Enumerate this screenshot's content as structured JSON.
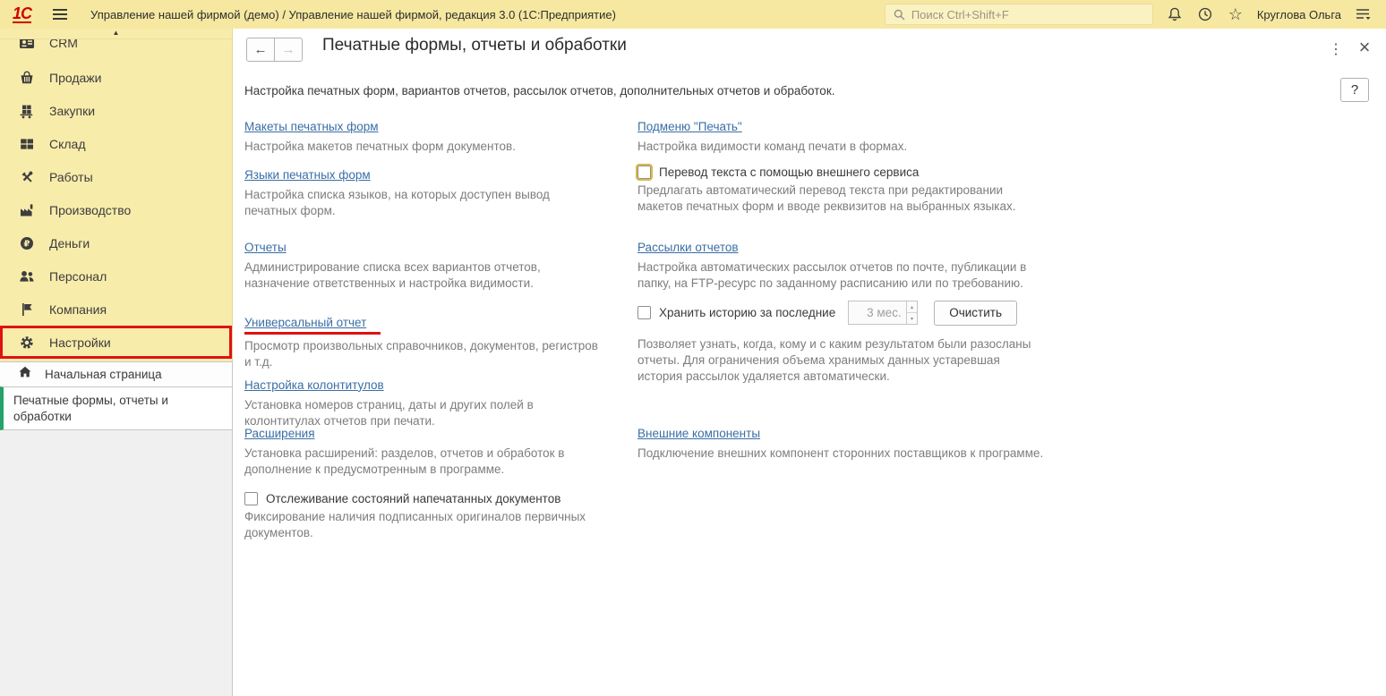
{
  "colors": {
    "topbar_yellow": "#f6e8a0",
    "sidebar_yellow": "#f8ecab",
    "search_yellow": "#fbf2c2",
    "link_blue": "#3a6ea5",
    "highlight_red": "#e01212",
    "tab_green": "#27a268",
    "desc_gray": "#7d7d7d"
  },
  "topbar": {
    "logo_text": "1С",
    "title": "Управление нашей фирмой (демо) / Управление нашей фирмой, редакция 3.0  (1С:Предприятие)",
    "search_placeholder": "Поиск Ctrl+Shift+F",
    "user_name": "Круглова Ольга",
    "icons": [
      "search-icon",
      "bell-icon",
      "history-icon",
      "star-icon",
      "menu-arrow-icon"
    ],
    "star_glyph": "☆"
  },
  "sidebar": {
    "scroll_up_glyph": "▲",
    "items": [
      {
        "label": "CRM",
        "icon": "crm-icon"
      },
      {
        "label": "Продажи",
        "icon": "sales-icon"
      },
      {
        "label": "Закупки",
        "icon": "purchases-icon"
      },
      {
        "label": "Склад",
        "icon": "warehouse-icon"
      },
      {
        "label": "Работы",
        "icon": "works-icon"
      },
      {
        "label": "Производство",
        "icon": "production-icon"
      },
      {
        "label": "Деньги",
        "icon": "money-icon"
      },
      {
        "label": "Персонал",
        "icon": "staff-icon"
      },
      {
        "label": "Компания",
        "icon": "company-icon"
      },
      {
        "label": "Настройки",
        "icon": "settings-icon",
        "highlighted": true
      }
    ],
    "home": {
      "label": "Начальная страница",
      "icon": "home-icon"
    },
    "active_tab": "Печатные формы, отчеты и обработки"
  },
  "content": {
    "back_glyph": "←",
    "forward_glyph": "→",
    "kebab_glyph": "⋮",
    "close_glyph": "×",
    "help_label": "?",
    "title": "Печатные формы, отчеты и обработки",
    "subtitle": "Настройка печатных форм, вариантов отчетов, рассылок отчетов, дополнительных отчетов и обработок.",
    "left_column": {
      "items": [
        {
          "type": "link",
          "label": "Макеты печатных форм",
          "desc": "Настройка макетов печатных форм документов."
        },
        {
          "type": "link",
          "label": "Языки печатных форм",
          "desc": "Настройка списка языков, на которых доступен вывод печатных форм."
        },
        {
          "type": "link",
          "label": "Отчеты",
          "desc": "Администрирование списка всех вариантов отчетов, назначение ответственных и настройка видимости."
        },
        {
          "type": "link",
          "label": "Универсальный отчет",
          "desc": "Просмотр произвольных справочников, документов, регистров и т.д.",
          "annotated": true
        },
        {
          "type": "link",
          "label": "Настройка колонтитулов",
          "desc": "Установка номеров страниц, даты и других полей в колонтитулах отчетов при печати."
        },
        {
          "type": "link",
          "label": "Расширения",
          "desc": "Установка расширений: разделов, отчетов и обработок в дополнение к предусмотренным в программе."
        },
        {
          "type": "checkbox",
          "checked": false,
          "label": "Отслеживание состояний напечатанных документов",
          "desc": "Фиксирование наличия подписанных оригиналов первичных документов."
        }
      ]
    },
    "right_column": {
      "items": [
        {
          "type": "link",
          "label": "Подменю \"Печать\"",
          "desc": "Настройка видимости команд печати в формах."
        },
        {
          "type": "checkbox",
          "checked": false,
          "focused": true,
          "label": "Перевод текста с помощью внешнего сервиса",
          "desc": "Предлагать автоматический перевод текста при редактировании макетов печатных форм и вводе реквизитов на выбранных языках."
        },
        {
          "type": "link",
          "label": "Рассылки отчетов",
          "desc": "Настройка автоматических рассылок отчетов по почте, публикации в папку, на FTP-ресурс по заданному расписанию или по требованию."
        },
        {
          "type": "checkbox-input",
          "checked": false,
          "label": "Хранить историю за последние",
          "value": "3 мес.",
          "spin_up_glyph": "▴",
          "spin_down_glyph": "▾",
          "button": "Очистить",
          "desc": "Позволяет узнать, когда, кому и с каким результатом были разосланы отчеты. Для ограничения объема хранимых данных устаревшая история рассылок удаляется автоматически."
        },
        {
          "type": "link",
          "label": "Внешние компоненты",
          "desc": "Подключение внешних компонент сторонних поставщиков к программе."
        }
      ]
    }
  }
}
